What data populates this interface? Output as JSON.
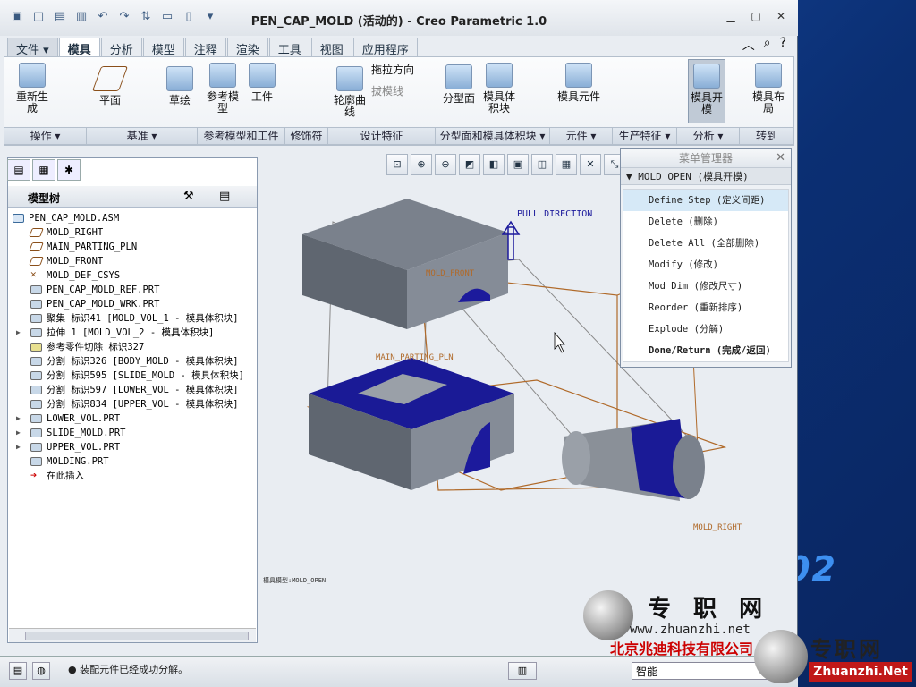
{
  "window": {
    "title": "PEN_CAP_MOLD (活动的) - Creo Parametric 1.0"
  },
  "tabs": [
    "文件 ▾",
    "模具",
    "分析",
    "模型",
    "注释",
    "渲染",
    "工具",
    "视图",
    "应用程序"
  ],
  "ribbon": {
    "buttons": [
      "重新生成",
      "平面",
      "草绘",
      "参考模型",
      "工件",
      "轮廓曲线",
      "拖拉方向",
      "拔模线",
      "分型面",
      "模具体积块",
      "模具元件",
      "模具开模",
      "模具布局"
    ],
    "groups": [
      "操作 ▾",
      "基准 ▾",
      "参考模型和工件",
      "修饰符",
      "设计特征",
      "分型面和模具体积块 ▾",
      "元件 ▾",
      "生产特征 ▾",
      "分析 ▾",
      "转到"
    ]
  },
  "model_tree": {
    "header": "模型树",
    "items": [
      {
        "label": "PEN_CAP_MOLD.ASM",
        "expand": ""
      },
      {
        "label": "MOLD_RIGHT",
        "expand": ""
      },
      {
        "label": "MAIN_PARTING_PLN",
        "expand": ""
      },
      {
        "label": "MOLD_FRONT",
        "expand": ""
      },
      {
        "label": "MOLD_DEF_CSYS",
        "expand": ""
      },
      {
        "label": "PEN_CAP_MOLD_REF.PRT",
        "expand": ""
      },
      {
        "label": "PEN_CAP_MOLD_WRK.PRT",
        "expand": ""
      },
      {
        "label": "聚集 标识41 [MOLD_VOL_1 - 模具体积块]",
        "expand": ""
      },
      {
        "label": "拉伸 1 [MOLD_VOL_2 - 模具体积块]",
        "expand": "▶"
      },
      {
        "label": "参考零件切除 标识327",
        "expand": ""
      },
      {
        "label": "分割 标识326 [BODY_MOLD - 模具体积块]",
        "expand": ""
      },
      {
        "label": "分割 标识595 [SLIDE_MOLD - 模具体积块]",
        "expand": ""
      },
      {
        "label": "分割 标识597 [LOWER_VOL - 模具体积块]",
        "expand": ""
      },
      {
        "label": "分割 标识834 [UPPER_VOL - 模具体积块]",
        "expand": ""
      },
      {
        "label": "LOWER_VOL.PRT",
        "expand": "▶"
      },
      {
        "label": "SLIDE_MOLD.PRT",
        "expand": "▶"
      },
      {
        "label": "UPPER_VOL.PRT",
        "expand": "▶"
      },
      {
        "label": "MOLDING.PRT",
        "expand": ""
      },
      {
        "label": "在此插入",
        "expand": ""
      }
    ]
  },
  "viewport": {
    "labels": {
      "pull_direction": "PULL DIRECTION",
      "mold_front": "MOLD_FRONT",
      "main_parting": "MAIN_PARTING_PLN",
      "mold_right": "MOLD_RIGHT",
      "mode": "模具模型:MOLD_OPEN"
    }
  },
  "menu_manager": {
    "title": "菜单管理器",
    "header": "MOLD OPEN (模具开模)",
    "items": [
      "Define Step (定义间距)",
      "Delete (删除)",
      "Delete All (全部删除)",
      "Modify (修改)",
      "Mod Dim (修改尺寸)",
      "Reorder (重新排序)",
      "Explode (分解)",
      "Done/Return (完成/返回)"
    ]
  },
  "status": {
    "message": "● 装配元件已经成功分解。",
    "filter": "智能"
  },
  "watermark": {
    "name": "专 职 网",
    "url": "www.zhuanzhi.net",
    "company": "北京兆迪科技有限公司",
    "brand2": "专职网",
    "brand2_url": "Zhuanzhi.Net",
    "desktop_text": "02"
  },
  "colors": {
    "accent": "#1a2a9a",
    "mold_grey": "#6d7480",
    "datum": "#b06a2a"
  }
}
